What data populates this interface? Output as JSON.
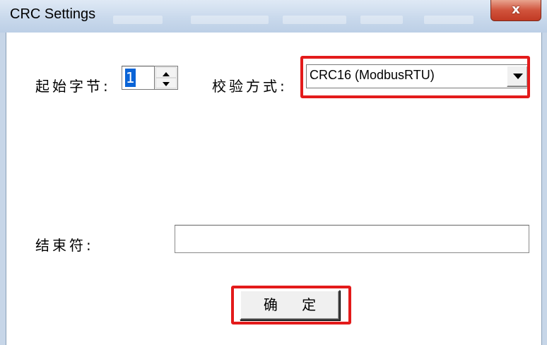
{
  "window": {
    "title": "CRC Settings",
    "close_glyph": "x"
  },
  "form": {
    "start_byte_label": "起始字节:",
    "start_byte_value": "1",
    "check_method_label": "校验方式:",
    "check_method_value": "CRC16 (ModbusRTU)",
    "end_char_label": "结束符:",
    "end_char_value": ""
  },
  "buttons": {
    "ok_label": "确 定"
  },
  "colors": {
    "highlight": "#e31b1b",
    "selection": "#0a64d7",
    "close_button": "#c9452e"
  }
}
